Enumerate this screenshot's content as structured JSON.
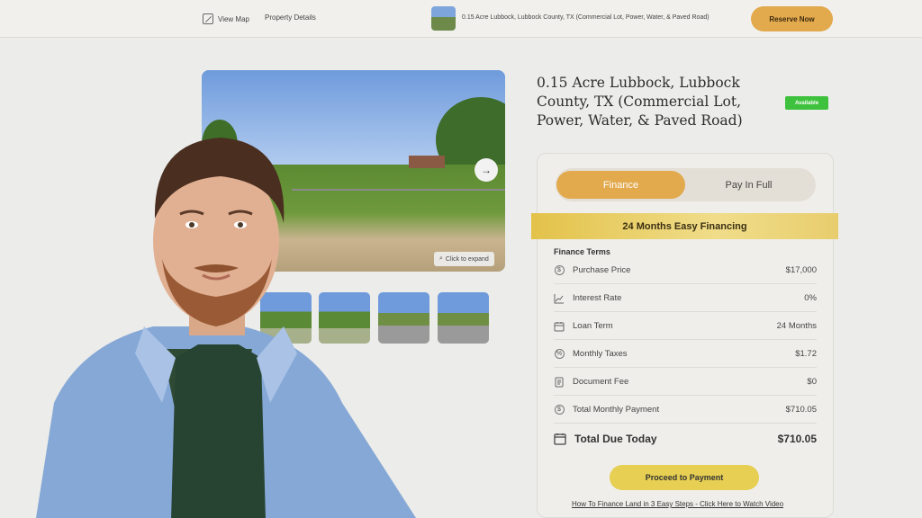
{
  "header": {
    "view_map": "View Map",
    "property_details": "Property Details",
    "listing_title": "0.15 Acre Lubbock, Lubbock County, TX (Commercial Lot, Power, Water, & Paved Road)",
    "reserve_label": "Reserve Now",
    "reserve_color": "#e2a94d"
  },
  "gallery": {
    "expand_label": "Click to expand",
    "next_icon": "→"
  },
  "property": {
    "title": "0.15 Acre Lubbock, Lubbock County, TX (Commercial Lot, Power, Water, & Paved Road)",
    "status": "Available",
    "status_color": "#3ec13c"
  },
  "purchase": {
    "tabs": [
      {
        "label": "Finance",
        "active": true
      },
      {
        "label": "Pay In Full",
        "active": false
      }
    ],
    "banner": "24 Months Easy Financing",
    "terms_title": "Finance Terms",
    "rows": [
      {
        "icon": "dollar-circle-icon",
        "label": "Purchase Price",
        "value": "$17,000"
      },
      {
        "icon": "trend-chart-icon",
        "label": "Interest Rate",
        "value": "0%"
      },
      {
        "icon": "calendar-icon",
        "label": "Loan Term",
        "value": "24 Months"
      },
      {
        "icon": "percent-circle-icon",
        "label": "Monthly Taxes",
        "value": "$1.72"
      },
      {
        "icon": "document-icon",
        "label": "Document Fee",
        "value": "$0"
      },
      {
        "icon": "dollar-circle-icon",
        "label": "Total Monthly Payment",
        "value": "$710.05"
      }
    ],
    "total": {
      "icon": "calendar-check-icon",
      "label": "Total Due Today",
      "value": "$710.05"
    },
    "proceed_label": "Proceed to Payment",
    "video_link": "How To Finance Land in 3 Easy Steps - Click Here to Watch Video",
    "accent": "#e2a94d"
  }
}
